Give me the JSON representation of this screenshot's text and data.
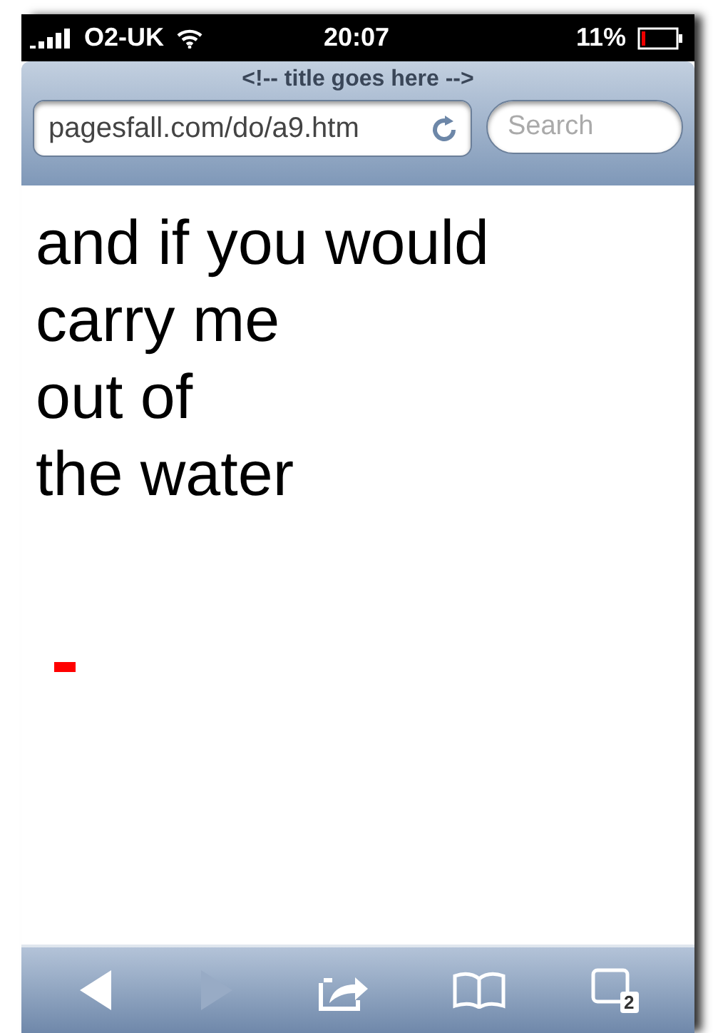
{
  "status_bar": {
    "carrier": "O2-UK",
    "time": "20:07",
    "battery_percent": "11%",
    "battery": {
      "level": 0.11
    }
  },
  "browser": {
    "title": "<!-- title goes here -->",
    "url": "pagesfall.com/do/a9.htm",
    "search": {
      "placeholder": "Search"
    }
  },
  "content": {
    "lines": [
      "and if you would",
      "carry me",
      "out of",
      "the water"
    ]
  },
  "toolbar": {
    "back": {
      "disabled": false
    },
    "forward": {
      "disabled": true
    },
    "tabs_count": "2"
  }
}
